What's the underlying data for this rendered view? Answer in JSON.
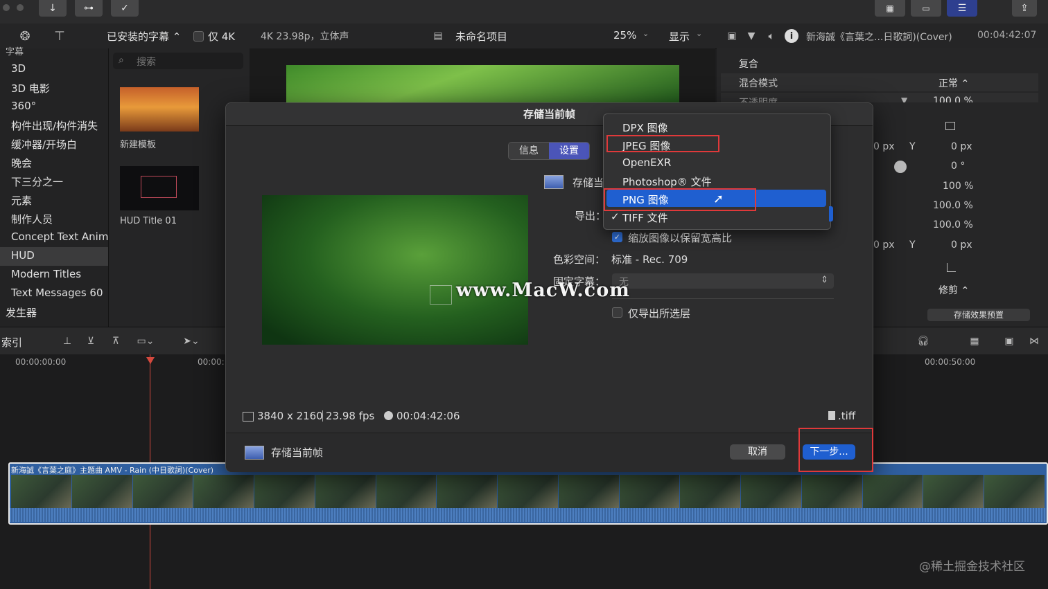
{
  "toolbar": {
    "import_icon": "↓",
    "keyword_icon": "⊶",
    "check_icon": "✓"
  },
  "browser_header": {
    "installed_titles": "已安装的字幕 ⌃",
    "only_4k": "仅 4K"
  },
  "viewer_header": {
    "format": "4K 23.98p，立体声",
    "project": "未命名项目",
    "zoom": "25%",
    "display": "显示"
  },
  "inspector_header": {
    "clip_title": "新海誠《言葉之...日歌詞)(Cover)",
    "timecode": "00:04:42:07"
  },
  "sidebar": {
    "section_label": "字幕",
    "items": [
      "3D",
      "3D 电影",
      "360°",
      "构件出现/构件消失",
      "缓冲器/开场白",
      "晚会",
      "下三分之一",
      "元素",
      "制作人员",
      "Concept Text Anima",
      "HUD",
      "Modern Titles",
      "Text Messages 60",
      "发生器"
    ],
    "selected_index": 10
  },
  "browser": {
    "search_placeholder": "搜索",
    "thumbs": [
      {
        "label": "新建模板"
      },
      {
        "label": "HUD Title 01"
      }
    ]
  },
  "inspector": {
    "composite": "复合",
    "blend_mode_label": "混合模式",
    "blend_mode_value": "正常 ⌃",
    "opacity_label": "不透明度",
    "opacity_value": "100.0 %",
    "rows": [
      {
        "a": "0 px",
        "b": "Y",
        "c": "0 px"
      },
      {
        "a": "",
        "b": "",
        "c": "0 °"
      },
      {
        "a": "",
        "b": "",
        "c": "100 %"
      },
      {
        "a": "",
        "b": "",
        "c": "100.0 %"
      },
      {
        "a": "",
        "b": "",
        "c": "100.0 %"
      },
      {
        "a": "0 px",
        "b": "Y",
        "c": "0 px"
      }
    ],
    "trim_value": "修剪 ⌃",
    "save_preset": "存储效果预置"
  },
  "timeline": {
    "index_label": "索引",
    "tc_left": "00:00:00:00",
    "tc_mid": "00:00:",
    "tc_right": "00:00:50:00",
    "clip_title": "新海誠《言葉之庭》主題曲 AMV - Rain (中日歌詞)(Cover)"
  },
  "dialog": {
    "title": "存储当前帧",
    "tab_info": "信息",
    "tab_settings": "设置",
    "save_label": "存储当",
    "export_label": "导出：",
    "keep_aspect": "缩放图像以保留宽高比",
    "colorspace_label": "色彩空间：",
    "colorspace_value": "标准 - Rec. 709",
    "captions_label": "固定字幕：",
    "captions_value": "无",
    "only_selected": "仅导出所选层",
    "resolution": "3840 x 2160",
    "fps": "23.98 fps",
    "duration": "00:04:42:06",
    "file_ext": ".tiff",
    "footer_title": "存储当前帧",
    "cancel": "取消",
    "next": "下一步..."
  },
  "export_menu": {
    "items": [
      "DPX 图像",
      "JPEG 图像",
      "OpenEXR",
      "Photoshop® 文件",
      "PNG 图像",
      "TIFF 文件"
    ],
    "highlighted_index": 4,
    "checked_index": 5
  },
  "watermark": "www.MacW.com",
  "credit": "@稀土掘金技术社区",
  "colors": {
    "accent": "#1f5fd0",
    "selection": "#4b55b8",
    "highlight_box": "#e0393a"
  }
}
